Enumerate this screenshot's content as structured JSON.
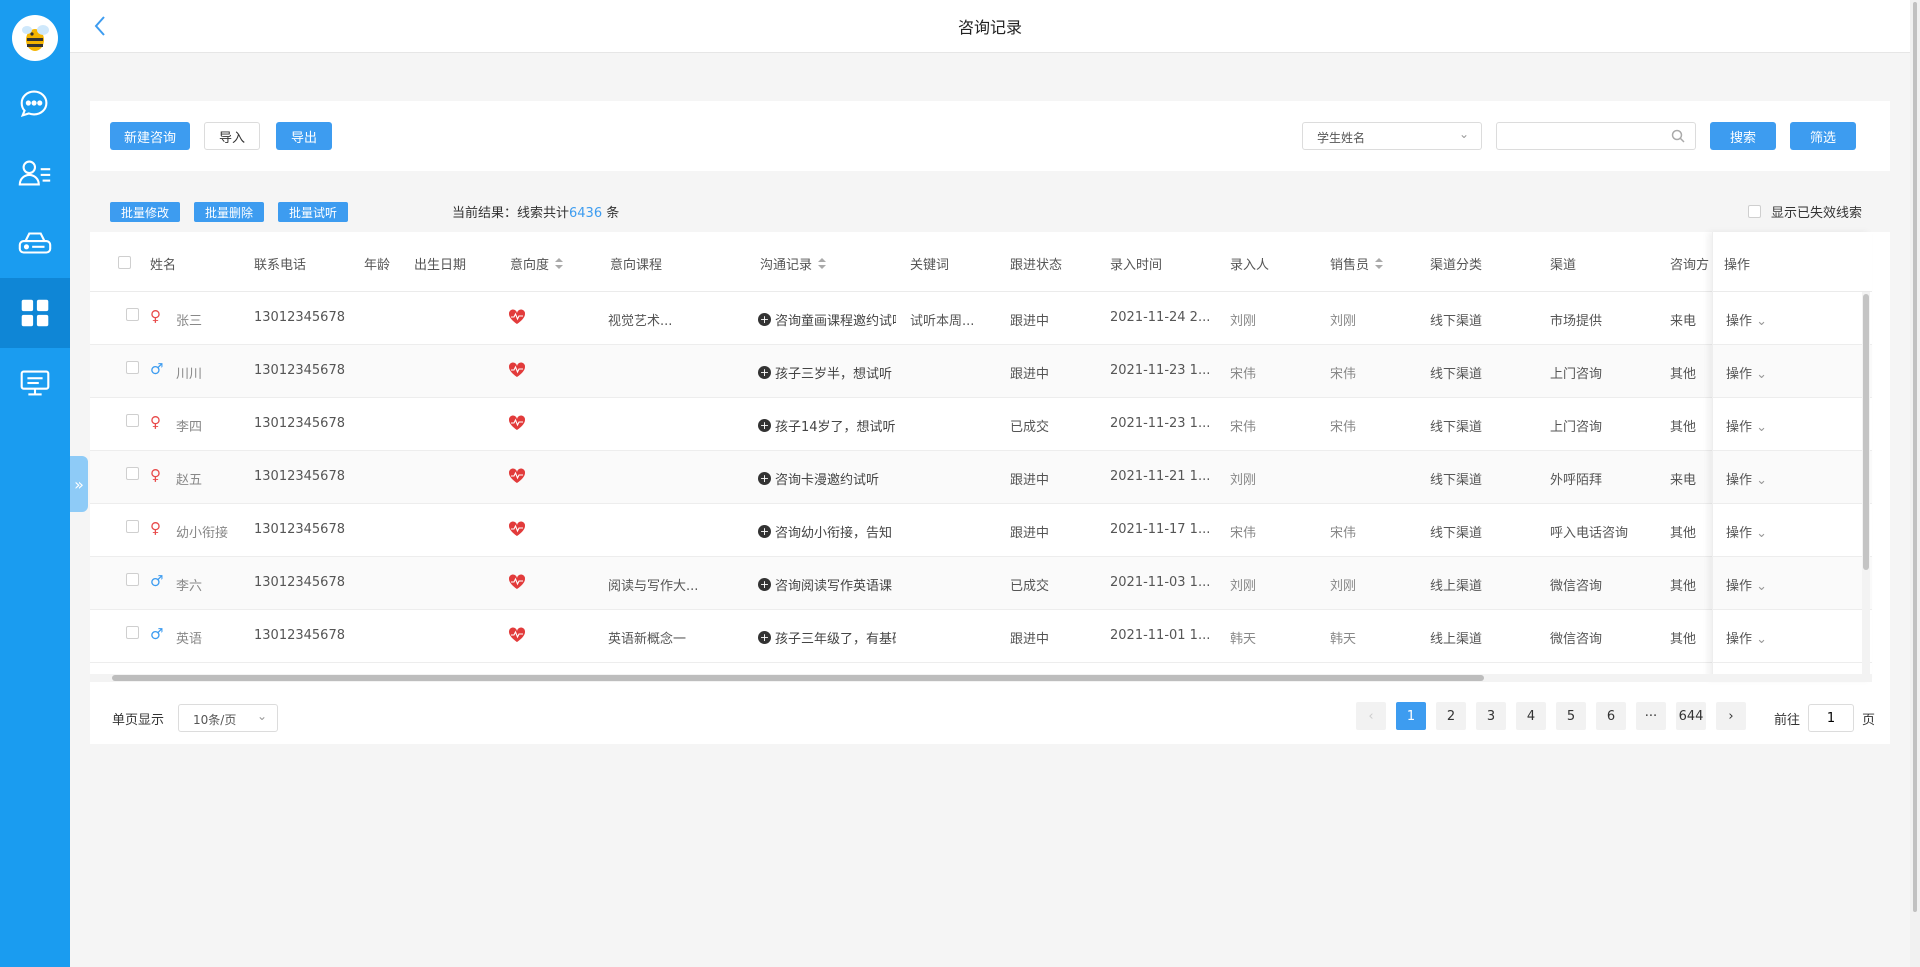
{
  "header": {
    "title": "咨询记录"
  },
  "toolbar": {
    "new_label": "新建咨询",
    "import_label": "导入",
    "export_label": "导出",
    "filter_select": "学生姓名",
    "search_value": "",
    "search_label": "搜索",
    "screen_label": "筛选"
  },
  "batch": {
    "modify_label": "批量修改",
    "delete_label": "批量删除",
    "trial_label": "批量试听",
    "result_prefix": "当前结果：线索共计",
    "result_count": "6436",
    "result_suffix": " 条",
    "show_invalid": "显示已失效线索"
  },
  "columns": {
    "name": "姓名",
    "phone": "联系电话",
    "age": "年龄",
    "birthday": "出生日期",
    "intent": "意向度",
    "course": "意向课程",
    "comm": "沟通记录",
    "keyword": "关键词",
    "status": "跟进状态",
    "entry_time": "录入时间",
    "entry_person": "录入人",
    "seller": "销售员",
    "channel_type": "渠道分类",
    "channel": "渠道",
    "consult_way": "咨询方",
    "ops": "操作"
  },
  "rows": [
    {
      "gender": "female",
      "name": "张三",
      "phone": "13012345678",
      "course": "视觉艺术...",
      "comm": "咨询童画课程邀约试听",
      "keyword": "试听本周...",
      "status": "跟进中",
      "time": "2021-11-24 2...",
      "entry": "刘刚",
      "seller": "刘刚",
      "channel_type": "线下渠道",
      "channel": "市场提供",
      "way": "来电",
      "op": "操作"
    },
    {
      "gender": "male",
      "name": "川川",
      "phone": "13012345678",
      "course": "",
      "comm": "孩子三岁半，想试听",
      "keyword": "",
      "status": "跟进中",
      "time": "2021-11-23 1...",
      "entry": "宋伟",
      "seller": "宋伟",
      "channel_type": "线下渠道",
      "channel": "上门咨询",
      "way": "其他",
      "op": "操作"
    },
    {
      "gender": "female",
      "name": "李四",
      "phone": "13012345678",
      "course": "",
      "comm": "孩子14岁了，想试听",
      "keyword": "",
      "status": "已成交",
      "time": "2021-11-23 1...",
      "entry": "宋伟",
      "seller": "宋伟",
      "channel_type": "线下渠道",
      "channel": "上门咨询",
      "way": "其他",
      "op": "操作"
    },
    {
      "gender": "female",
      "name": "赵五",
      "phone": "13012345678",
      "course": "",
      "comm": "咨询卡漫邀约试听",
      "keyword": "",
      "status": "跟进中",
      "time": "2021-11-21 1...",
      "entry": "刘刚",
      "seller": "",
      "channel_type": "线下渠道",
      "channel": "外呼陌拜",
      "way": "来电",
      "op": "操作"
    },
    {
      "gender": "female",
      "name": "幼小衔接",
      "phone": "13012345678",
      "course": "",
      "comm": "咨询幼小衔接，告知",
      "keyword": "",
      "status": "跟进中",
      "time": "2021-11-17 1...",
      "entry": "宋伟",
      "seller": "宋伟",
      "channel_type": "线下渠道",
      "channel": "呼入电话咨询",
      "way": "其他",
      "op": "操作"
    },
    {
      "gender": "male",
      "name": "李六",
      "phone": "13012345678",
      "course": "阅读与写作大...",
      "comm": "咨询阅读写作英语课",
      "keyword": "",
      "status": "已成交",
      "time": "2021-11-03 1...",
      "entry": "刘刚",
      "seller": "刘刚",
      "channel_type": "线上渠道",
      "channel": "微信咨询",
      "way": "其他",
      "op": "操作"
    },
    {
      "gender": "male",
      "name": "英语",
      "phone": "13012345678",
      "course": "英语新概念一",
      "comm": "孩子三年级了，有基础",
      "keyword": "",
      "status": "跟进中",
      "time": "2021-11-01 1...",
      "entry": "韩天",
      "seller": "韩天",
      "channel_type": "线上渠道",
      "channel": "微信咨询",
      "way": "其他",
      "op": "操作"
    }
  ],
  "pagination": {
    "page_size_label": "单页显示",
    "page_size": "10条/页",
    "pages": [
      "1",
      "2",
      "3",
      "4",
      "5",
      "6",
      "···",
      "644"
    ],
    "current": "1",
    "goto_prefix": "前往",
    "goto_value": "1",
    "goto_suffix": "页"
  },
  "colors": {
    "sidebar": "#1a9cf0",
    "primary": "#3d9cf0"
  },
  "icons": [
    "logo-bee-icon",
    "chat-icon",
    "user-list-icon",
    "router-icon",
    "grid-icon",
    "monitor-icon",
    "back-icon",
    "search-icon",
    "heart-icon",
    "plus-circle-icon"
  ]
}
